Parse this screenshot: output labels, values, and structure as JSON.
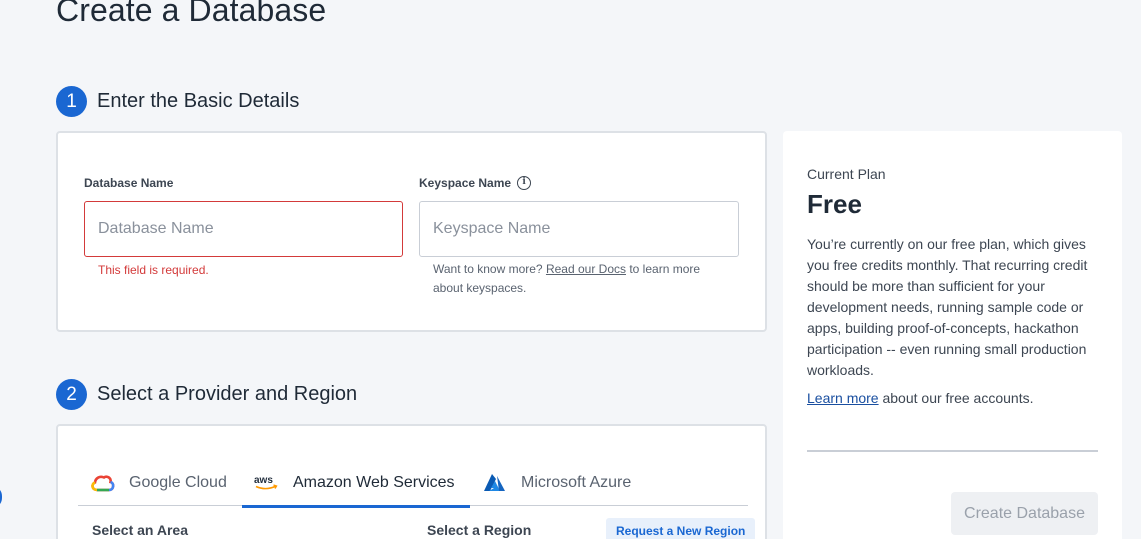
{
  "page_title": "Create a Database",
  "step1": {
    "number": "1",
    "title": "Enter the Basic Details",
    "db_name": {
      "label": "Database Name",
      "placeholder": "Database Name",
      "value": "",
      "error": "This field is required."
    },
    "keyspace": {
      "label": "Keyspace Name",
      "placeholder": "Keyspace Name",
      "value": "",
      "help_prefix": "Want to know more?",
      "help_link": "Read our Docs",
      "help_suffix": "to learn more",
      "help_line2": "about keyspaces."
    }
  },
  "step2": {
    "number": "2",
    "title": "Select a Provider and Region",
    "tabs": [
      {
        "label": "Google Cloud",
        "icon": "google-cloud-icon"
      },
      {
        "label": "Amazon Web Services",
        "icon": "aws-icon",
        "active": true
      },
      {
        "label": "Microsoft Azure",
        "icon": "azure-icon"
      }
    ],
    "area_label": "Select an Area",
    "region_label": "Select a Region",
    "request_region": "Request a New Region"
  },
  "plan": {
    "caption": "Current Plan",
    "name": "Free",
    "description": "You’re currently on our free plan, which gives you free credits monthly. That recurring credit should be more than sufficient for your development needs, running sample code or apps, building proof-of-concepts, hackathon participation -- even running small production workloads.",
    "learn_link": "Learn more",
    "learn_suffix": "about our free accounts.",
    "create_button": "Create Database"
  },
  "colors": {
    "accent": "#1a67d2",
    "error": "#d33a3a",
    "background": "#f4f6f9"
  }
}
